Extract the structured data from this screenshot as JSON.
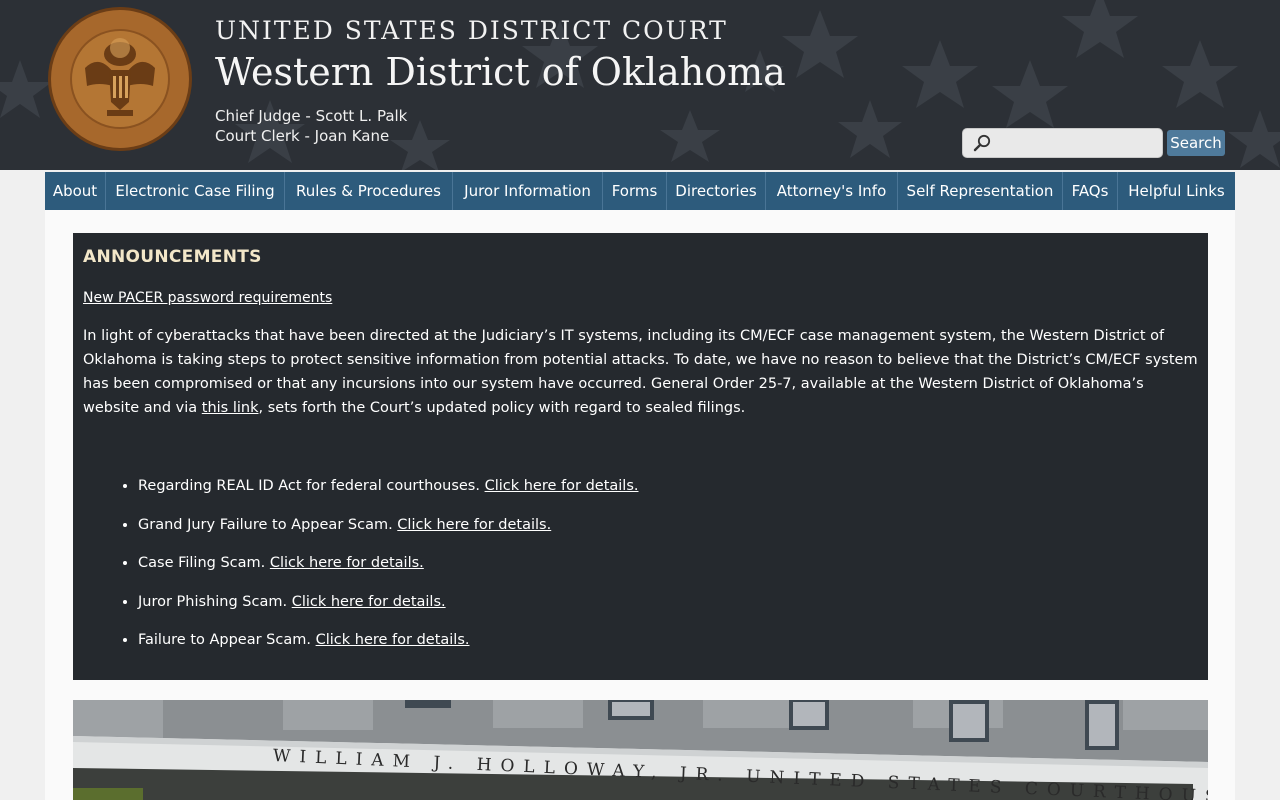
{
  "header": {
    "court_name": "UNITED STATES DISTRICT COURT",
    "district_name": "Western District of Oklahoma",
    "chief_judge": "Chief Judge - Scott L. Palk",
    "court_clerk": "Court Clerk - Joan Kane",
    "seal": {
      "top_text": "UNITED STATES DISTRICT COURT",
      "bottom_text": "WESTERN DISTRICT OF OKLAHOMA",
      "icon": "court-seal-eagle"
    }
  },
  "search": {
    "placeholder": "",
    "value": "",
    "button_label": "Search",
    "icon": "magnifier-icon"
  },
  "nav": {
    "items": [
      {
        "label": "About"
      },
      {
        "label": "Electronic Case Filing"
      },
      {
        "label": "Rules & Procedures"
      },
      {
        "label": "Juror Information"
      },
      {
        "label": "Forms"
      },
      {
        "label": "Directories"
      },
      {
        "label": "Attorney's Info"
      },
      {
        "label": "Self Representation"
      },
      {
        "label": "FAQs"
      },
      {
        "label": "Helpful Links"
      }
    ]
  },
  "announcements": {
    "title": "ANNOUNCEMENTS",
    "pacer_link": "New PACER password requirements",
    "body_text": "In light of cyberattacks that have been directed at the Judiciary’s IT systems, including its CM/ECF case management system, the Western District of Oklahoma is taking steps to protect sensitive information from potential attacks. To date, we have no reason to believe that the District’s CM/ECF system has been compromised or that any incursions into our system have occurred. General Order 25-7, available at the Western District of Oklahoma’s website and via",
    "body_link": "this link",
    "body_tail": ", sets forth the Court’s updated policy with regard to sealed filings.",
    "items": [
      {
        "text": "Regarding REAL ID Act for federal courthouses.",
        "link": "Click here for details."
      },
      {
        "text": "Grand Jury Failure to Appear Scam.",
        "link": "Click here for details."
      },
      {
        "text": "Case Filing Scam.",
        "link": "Click here for details."
      },
      {
        "text": "Juror Phishing Scam.",
        "link": "Click here for details."
      },
      {
        "text": "Failure to Appear Scam.",
        "link": "Click here for details."
      }
    ]
  },
  "photo": {
    "inscription": "WILLIAM J. HOLLOWAY, JR. UNITED STATES COURTHOUSE"
  },
  "colors": {
    "header_bg": "#2c3036",
    "nav_bg": "#2d5b7c",
    "announce_bg": "#25292e",
    "announce_title": "#f3e7c9",
    "search_button": "#4f7a9b"
  }
}
